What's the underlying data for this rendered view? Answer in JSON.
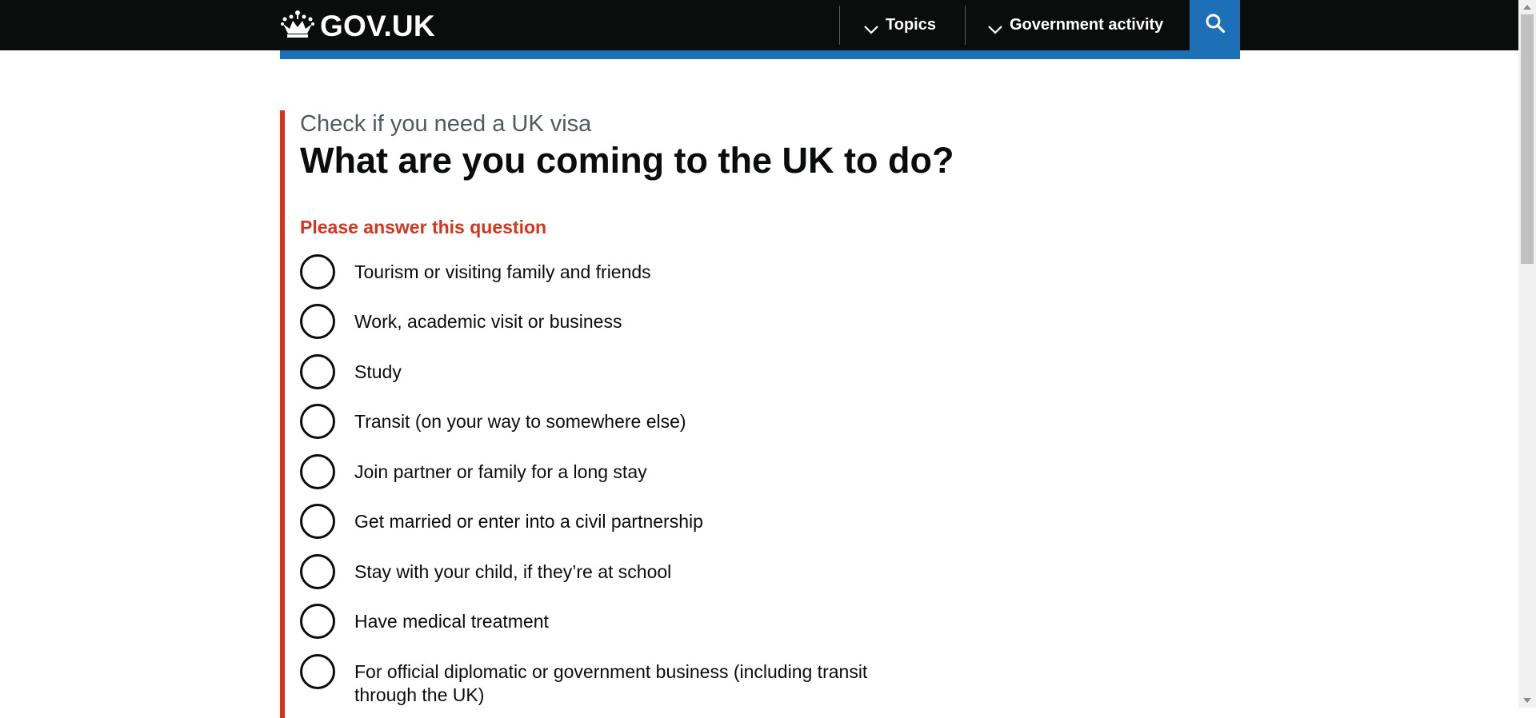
{
  "header": {
    "logo_text": "GOV.UK",
    "nav": {
      "topics_label": "Topics",
      "government_activity_label": "Government activity"
    },
    "search_icon": "search-icon",
    "colors": {
      "header_bg": "#0b0c0c",
      "accent_blue": "#1d70b8"
    }
  },
  "main": {
    "caption": "Check if you need a UK visa",
    "heading": "What are you coming to the UK to do?",
    "error_message": "Please answer this question",
    "error_color": "#d4351c",
    "options": [
      {
        "label": "Tourism or visiting family and friends"
      },
      {
        "label": "Work, academic visit or business"
      },
      {
        "label": "Study"
      },
      {
        "label": "Transit (on your way to somewhere else)"
      },
      {
        "label": "Join partner or family for a long stay"
      },
      {
        "label": "Get married or enter into a civil partnership"
      },
      {
        "label": "Stay with your child, if they’re at school"
      },
      {
        "label": "Have medical treatment"
      },
      {
        "label": "For official diplomatic or government business (including transit through the UK)"
      }
    ]
  }
}
